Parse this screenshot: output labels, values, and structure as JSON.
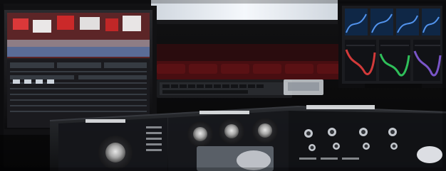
{
  "scene": {
    "description_free": true,
    "palette": {
      "room_dark": "#0b0b0c",
      "wall_red": "#4a0f12",
      "seats_red": "#6a1418",
      "screen_glow": "#e8eef6",
      "console_black": "#141416",
      "console_gray": "#2a2c30",
      "scope_blue": "#2b5b9b",
      "scope_red": "#d23a3a",
      "scope_green": "#2fbf5a",
      "scope_purple": "#7a55c8"
    }
  }
}
